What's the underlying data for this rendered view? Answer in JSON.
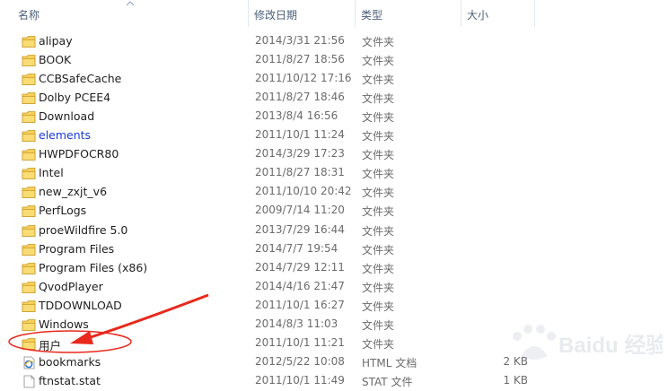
{
  "columns": {
    "name": "名称",
    "date": "修改日期",
    "type": "类型",
    "size": "大小"
  },
  "files": [
    {
      "name": "alipay",
      "date": "2014/3/31 21:56",
      "type": "文件夹",
      "size": "",
      "icon": "folder-icon"
    },
    {
      "name": "BOOK",
      "date": "2011/8/27 18:56",
      "type": "文件夹",
      "size": "",
      "icon": "folder-icon"
    },
    {
      "name": "CCBSafeCache",
      "date": "2011/10/12 17:16",
      "type": "文件夹",
      "size": "",
      "icon": "folder-icon"
    },
    {
      "name": "Dolby PCEE4",
      "date": "2011/8/27 18:46",
      "type": "文件夹",
      "size": "",
      "icon": "folder-icon"
    },
    {
      "name": "Download",
      "date": "2013/8/4 16:56",
      "type": "文件夹",
      "size": "",
      "icon": "folder-icon"
    },
    {
      "name": "elements",
      "date": "2011/10/1 11:24",
      "type": "文件夹",
      "size": "",
      "icon": "folder-icon",
      "highlight": true
    },
    {
      "name": "HWPDFOCR80",
      "date": "2014/3/29 17:23",
      "type": "文件夹",
      "size": "",
      "icon": "folder-icon"
    },
    {
      "name": "Intel",
      "date": "2011/8/27 18:31",
      "type": "文件夹",
      "size": "",
      "icon": "folder-icon"
    },
    {
      "name": "new_zxjt_v6",
      "date": "2011/10/10 20:42",
      "type": "文件夹",
      "size": "",
      "icon": "folder-icon"
    },
    {
      "name": "PerfLogs",
      "date": "2009/7/14 11:20",
      "type": "文件夹",
      "size": "",
      "icon": "folder-icon"
    },
    {
      "name": "proeWildfire 5.0",
      "date": "2013/7/29 16:44",
      "type": "文件夹",
      "size": "",
      "icon": "folder-icon"
    },
    {
      "name": "Program Files",
      "date": "2014/7/7 19:54",
      "type": "文件夹",
      "size": "",
      "icon": "folder-icon"
    },
    {
      "name": "Program Files (x86)",
      "date": "2014/7/29 12:11",
      "type": "文件夹",
      "size": "",
      "icon": "folder-icon"
    },
    {
      "name": "QvodPlayer",
      "date": "2014/4/16 21:47",
      "type": "文件夹",
      "size": "",
      "icon": "folder-icon"
    },
    {
      "name": "TDDOWNLOAD",
      "date": "2011/10/1 16:27",
      "type": "文件夹",
      "size": "",
      "icon": "folder-icon"
    },
    {
      "name": "Windows",
      "date": "2014/8/3 11:03",
      "type": "文件夹",
      "size": "",
      "icon": "folder-icon"
    },
    {
      "name": "用户",
      "date": "2011/10/1 11:21",
      "type": "文件夹",
      "size": "",
      "icon": "folder-icon"
    },
    {
      "name": "bookmarks",
      "date": "2012/5/22 10:08",
      "type": "HTML 文档",
      "size": "2 KB",
      "icon": "ie-html-icon"
    },
    {
      "name": "ftnstat.stat",
      "date": "2011/10/1 11:49",
      "type": "STAT 文件",
      "size": "1 KB",
      "icon": "file-icon"
    }
  ],
  "annotation": {
    "color": "#e8291c",
    "target": "用户"
  },
  "watermark": {
    "text": "Baidu 经验"
  }
}
